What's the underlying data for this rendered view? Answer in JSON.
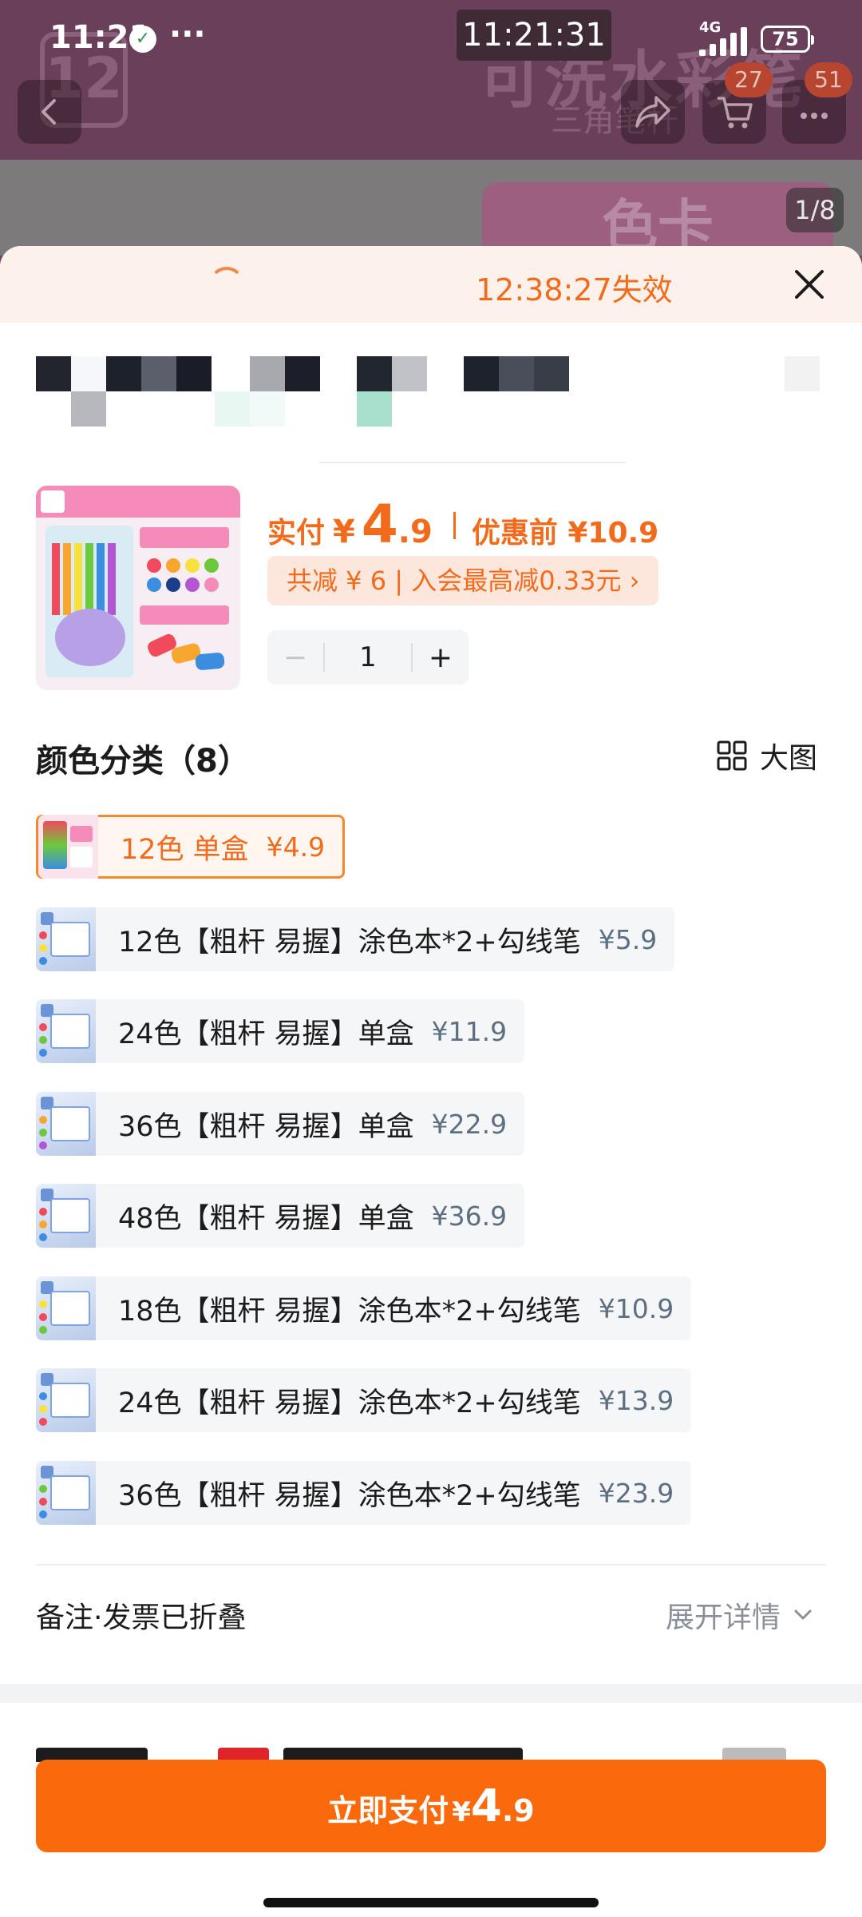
{
  "status_bar": {
    "time": "11:21",
    "app_glyph": "✓",
    "more_dots": "···",
    "clock": "11:21:31",
    "network": "4G",
    "battery": "75"
  },
  "background": {
    "brand_title": "可洗水彩笔",
    "brand_subtitle": "三角笔杆",
    "logo_text": "12",
    "color_card": "色卡",
    "image_counter": "1/8",
    "cart_badge": "27",
    "message_badge": "51"
  },
  "coupon": {
    "timer_text": "12:38:27失效"
  },
  "product": {
    "price_label": "实付",
    "currency": "¥",
    "price_int": "4",
    "price_dec": ".9",
    "original_price": "优惠前 ¥10.9",
    "discount_text": "共减 ¥ 6 | 入会最高减0.33元 ›",
    "quantity": "1",
    "minus": "−",
    "plus": "+"
  },
  "variants": {
    "title": "颜色分类（8）",
    "big_view_label": "大图",
    "options": [
      {
        "label": "12色  单盒",
        "price": "¥4.9",
        "selected": true
      },
      {
        "label": "12色【粗杆 易握】涂色本*2+勾线笔",
        "price": "¥5.9",
        "selected": false
      },
      {
        "label": "24色【粗杆 易握】单盒",
        "price": "¥11.9",
        "selected": false
      },
      {
        "label": "36色【粗杆 易握】单盒",
        "price": "¥22.9",
        "selected": false
      },
      {
        "label": "48色【粗杆 易握】单盒",
        "price": "¥36.9",
        "selected": false
      },
      {
        "label": "18色【粗杆 易握】涂色本*2+勾线笔",
        "price": "¥10.9",
        "selected": false
      },
      {
        "label": "24色【粗杆 易握】涂色本*2+勾线笔",
        "price": "¥13.9",
        "selected": false
      },
      {
        "label": "36色【粗杆 易握】涂色本*2+勾线笔",
        "price": "¥23.9",
        "selected": false
      }
    ]
  },
  "remarks": {
    "label": "备注·发票已折叠",
    "expand": "展开详情"
  },
  "pay": {
    "label": "立即支付",
    "currency": "¥",
    "amount_int": "4",
    "amount_dec": ".9"
  },
  "colors": {
    "accent": "#f26b1d",
    "pay_button": "#fa6a0c",
    "selected_border": "#f5872d"
  }
}
